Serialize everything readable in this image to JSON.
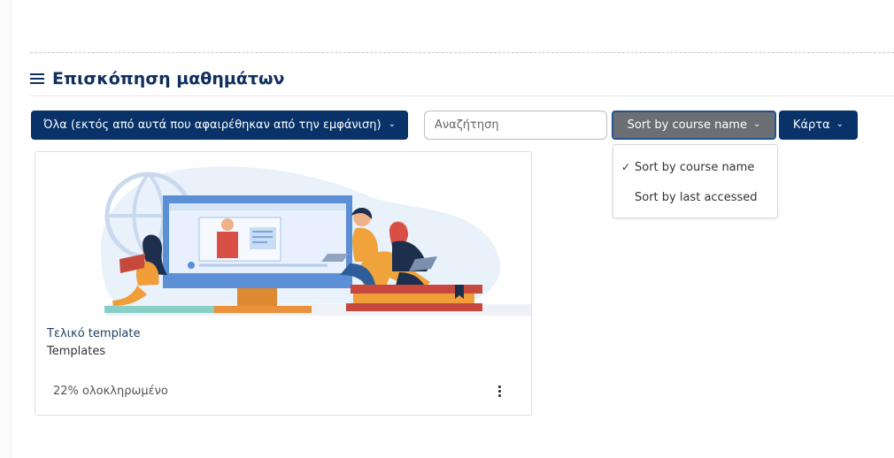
{
  "header": {
    "title": "Επισκόπηση μαθημάτων"
  },
  "filters": {
    "grouping_label": "Όλα (εκτός από αυτά που αφαιρέθηκαν από την εμφάνιση)",
    "search_placeholder": "Αναζήτηση",
    "sort_label": "Sort by course name",
    "view_label": "Κάρτα"
  },
  "sort_dropdown": {
    "items": [
      {
        "label": "Sort by course name",
        "selected": true
      },
      {
        "label": "Sort by last accessed",
        "selected": false
      }
    ],
    "check_icon": "✓"
  },
  "course": {
    "name": "Τελικό template",
    "category": "Templates",
    "progress_text": "22% ολοκληρωμένο",
    "progress_percent": 22
  },
  "colors": {
    "primary": "#083268",
    "title": "#0f2f5f",
    "sort_active": "#6b6f73",
    "illustration_blue": "#5b8fd6",
    "illustration_orange": "#f0a33b",
    "illustration_red": "#c7483c"
  },
  "icons": {
    "hamburger": "hamburger-icon",
    "chevron": "chevron-down-icon",
    "check": "check-icon",
    "more": "more-vertical-icon"
  }
}
